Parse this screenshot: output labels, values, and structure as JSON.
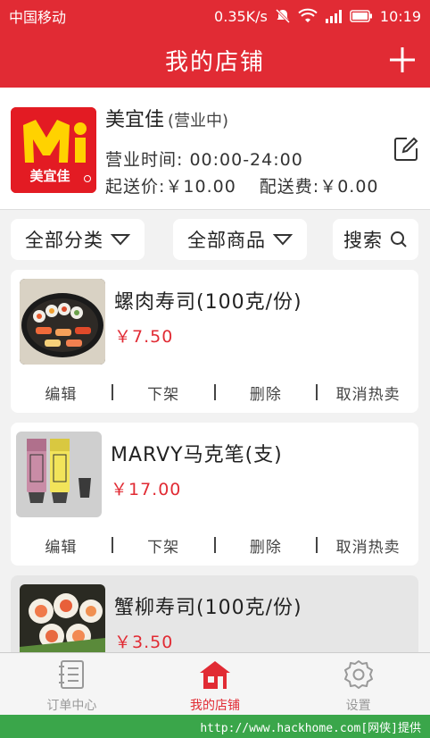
{
  "status_bar": {
    "carrier": "中国移动",
    "speed": "0.35K/s",
    "time": "10:19"
  },
  "header": {
    "title": "我的店铺",
    "add_icon": "plus-icon"
  },
  "store": {
    "logo_text": "美宜佳",
    "name": "美宜佳",
    "status": "(营业中)",
    "hours": "营业时间: 00:00-24:00",
    "min_order": "起送价:￥10.00",
    "delivery_fee": "配送费:￥0.00",
    "edit_icon": "edit-icon"
  },
  "filters": {
    "category": "全部分类",
    "products": "全部商品",
    "search": "搜索"
  },
  "products": [
    {
      "name": "螺肉寿司(100克/份)",
      "price": "￥7.50",
      "actions": [
        "编辑",
        "下架",
        "删除",
        "取消热卖"
      ]
    },
    {
      "name": "MARVY马克笔(支)",
      "price": "￥17.00",
      "actions": [
        "编辑",
        "下架",
        "删除",
        "取消热卖"
      ]
    },
    {
      "name": "蟹柳寿司(100克/份)",
      "price": "￥3.50",
      "actions": []
    }
  ],
  "bottom_nav": [
    {
      "label": "订单中心",
      "icon": "order-list-icon",
      "active": false
    },
    {
      "label": "我的店铺",
      "icon": "store-icon",
      "active": true
    },
    {
      "label": "设置",
      "icon": "gear-icon",
      "active": false
    }
  ],
  "watermark": "http://www.hackhome.com[网侠]提供",
  "colors": {
    "brand_red": "#e12b34",
    "watermark_green": "#3aa64a"
  }
}
